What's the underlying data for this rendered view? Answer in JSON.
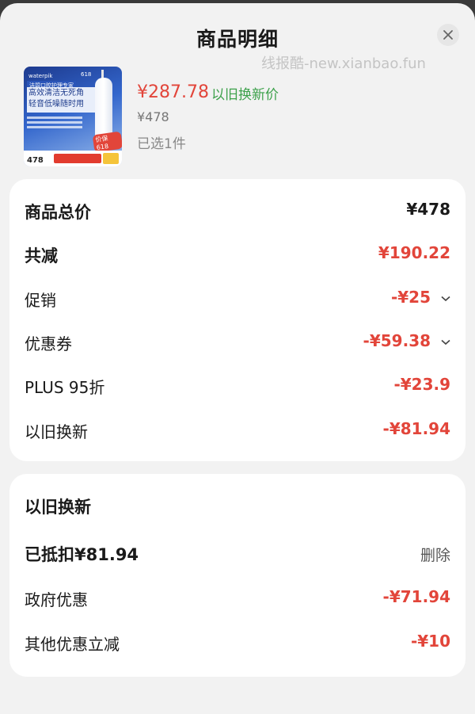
{
  "header": {
    "title": "商品明细",
    "watermark": "线报酷-new.xianbao.fun"
  },
  "product": {
    "price": "¥287.78",
    "price_label": "以旧换新价",
    "original_price": "¥478",
    "selected": "已选1件",
    "image": {
      "brand": "waterpik",
      "brand_tag": "618",
      "tagline": "洁碧口腔护理专家",
      "headline_1": "高效清洁无死角",
      "headline_2": "轻音低噪随时用",
      "price_tag": "478",
      "promo": "价保618"
    }
  },
  "summary": {
    "rows": [
      {
        "label": "商品总价",
        "value": "¥478"
      },
      {
        "label": "共减",
        "value": "¥190.22"
      },
      {
        "label": "促销",
        "value": "-¥25"
      },
      {
        "label": "优惠券",
        "value": "-¥59.38"
      },
      {
        "label": "PLUS 95折",
        "value": "-¥23.9"
      },
      {
        "label": "以旧换新",
        "value": "-¥81.94"
      }
    ]
  },
  "trade_in": {
    "title": "以旧换新",
    "deducted": "已抵扣¥81.94",
    "delete_label": "删除",
    "rows": [
      {
        "label": "政府优惠",
        "value": "-¥71.94"
      },
      {
        "label": "其他优惠立减",
        "value": "-¥10"
      }
    ]
  },
  "colors": {
    "accent_red": "#e2453a",
    "trade_green": "#3da14b"
  },
  "icons": [
    "close-icon",
    "chevron-down-icon"
  ]
}
